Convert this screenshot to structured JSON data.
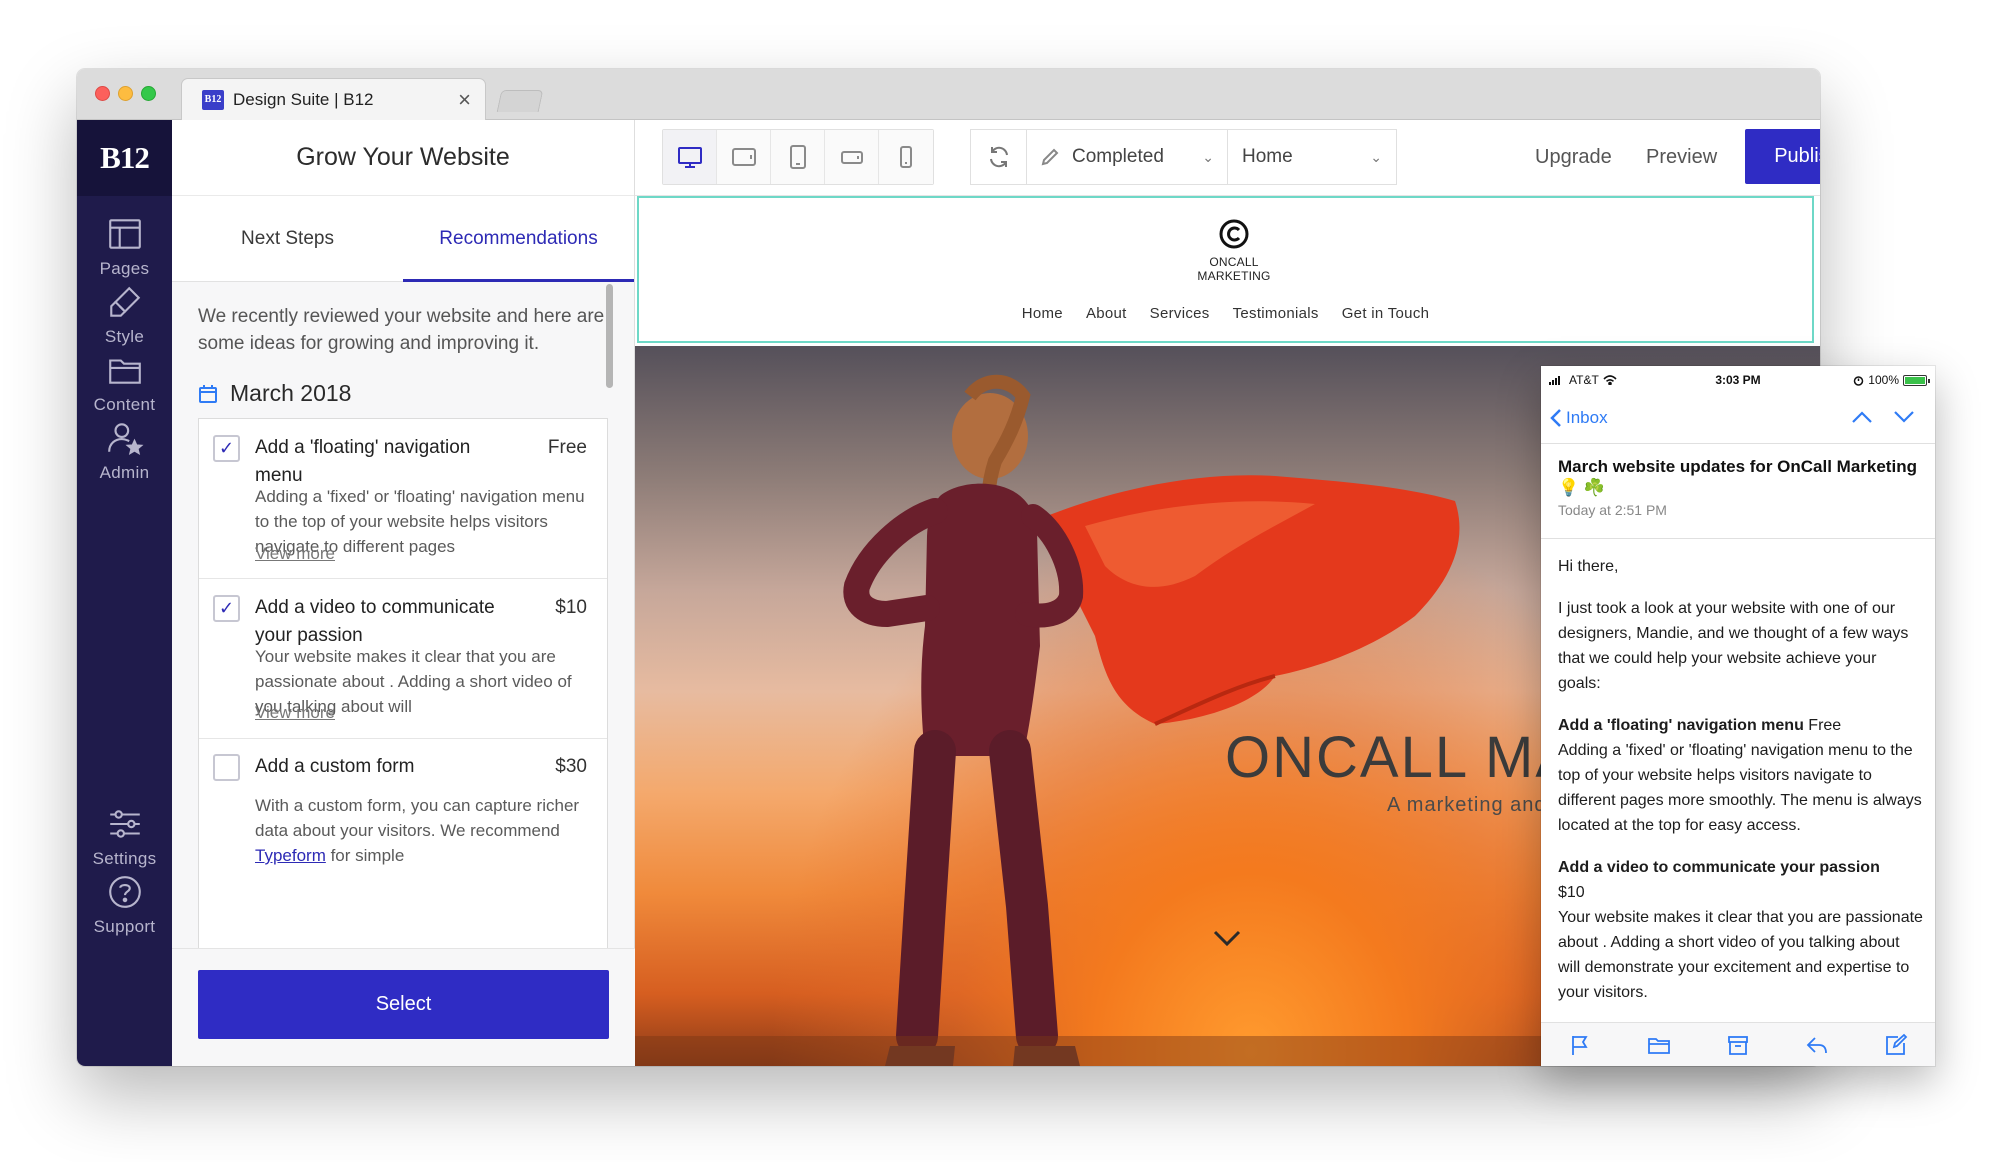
{
  "browser": {
    "tab_title": "Design Suite | B12",
    "favicon_text": "B12",
    "close_glyph": "×"
  },
  "sidenav": {
    "logo": "B12",
    "items": [
      {
        "label": "Pages",
        "icon": "layout-icon"
      },
      {
        "label": "Style",
        "icon": "brush-icon"
      },
      {
        "label": "Content",
        "icon": "folder-icon"
      },
      {
        "label": "Admin",
        "icon": "user-star-icon"
      },
      {
        "label": "Settings",
        "icon": "sliders-icon"
      },
      {
        "label": "Support",
        "icon": "help-icon"
      }
    ]
  },
  "panel": {
    "title": "Grow Your Website",
    "tabs": [
      {
        "label": "Next Steps",
        "active": false
      },
      {
        "label": "Recommendations",
        "active": true
      }
    ],
    "intro": "We recently reviewed your website and here are some ideas for growing and improving it.",
    "month": "March 2018",
    "recommendations": [
      {
        "title": "Add a 'floating' navigation menu",
        "price": "Free",
        "checked": true,
        "check_glyph": "✓",
        "description": "Adding a 'fixed' or 'floating' navigation menu to the top of your website helps visitors navigate to different pages",
        "more": "View more"
      },
      {
        "title": "Add a video to communicate your passion",
        "price": "$10",
        "checked": true,
        "check_glyph": "✓",
        "description": "Your website makes it clear that you are passionate about . Adding a short video of you talking about will",
        "more": "View more"
      },
      {
        "title": "Add a custom form",
        "price": "$30",
        "checked": false,
        "description_start": "With a custom form, you can capture richer data about your visitors. We recommend ",
        "description_link": "Typeform",
        "description_end": " for simple"
      }
    ],
    "select_label": "Select"
  },
  "toolbar": {
    "devices": [
      "desktop-icon",
      "tablet-landscape-icon",
      "tablet-portrait-icon",
      "phone-landscape-icon",
      "phone-portrait-icon"
    ],
    "active_device": "desktop-icon",
    "status": "Completed",
    "page": "Home",
    "upgrade": "Upgrade",
    "preview": "Preview",
    "publish": "Publish",
    "chevron_glyph": "⌄"
  },
  "site": {
    "logo_line1": "ONCALL",
    "logo_line2": "MARKETING",
    "nav": [
      "Home",
      "About",
      "Services",
      "Testimonials",
      "Get in Touch"
    ],
    "hero_title": "ONCALL MA",
    "hero_subtitle": "A marketing and",
    "accent": "#6ed8c7"
  },
  "phone": {
    "carrier": "AT&T",
    "time": "3:03 PM",
    "battery": "100%",
    "battery_level": 1.0,
    "back": "Inbox",
    "subject": "March website updates for OnCall Marketing 💡 ☘️",
    "date": "Today at 2:51 PM",
    "greeting": "Hi there,",
    "intro": "I just took a look at your website with one of our designers, Mandie, and we thought of a few ways that we could help your website achieve your goals:",
    "item1_title": "Add a 'floating' navigation menu",
    "item1_price": " Free",
    "item1_body": "Adding a 'fixed' or 'floating' navigation menu to the top of your website helps visitors navigate to different pages more smoothly. The menu is always located at the top for easy access.",
    "item2_title": "Add a video to communicate your passion",
    "item2_price": "$10",
    "item2_body": "Your website makes it clear that you are passionate about . Adding a short video of you talking about will demonstrate your excitement and expertise to your visitors.",
    "toolbar_icons": [
      "flag-icon",
      "folder-icon",
      "archive-icon",
      "reply-icon",
      "compose-icon"
    ]
  },
  "colors": {
    "primary": "#2f2cc4",
    "sidebar": "#1f1b4b",
    "link_blue": "#2f7bf5"
  }
}
